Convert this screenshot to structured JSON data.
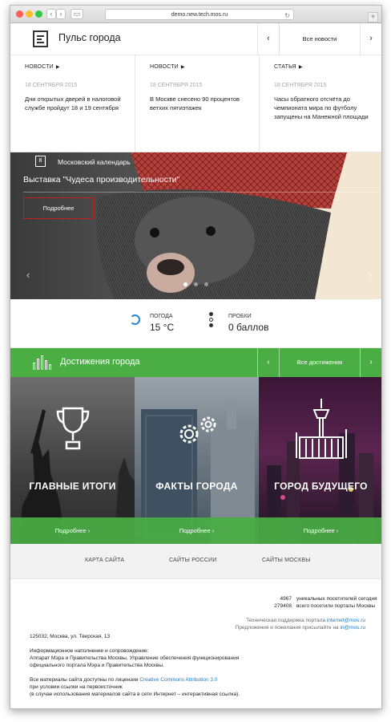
{
  "browser": {
    "url": "demo.new.tech.mos.ru"
  },
  "pulse": {
    "title": "Пульс города",
    "all_news": "Все новости",
    "prev": "‹",
    "next": "›",
    "news": [
      {
        "category": "НОВОСТИ",
        "date": "18 СЕНТЯБРЯ 2015",
        "title": "Дни открытых дверей в налоговой службе пройдут 18 и 19 сентября"
      },
      {
        "category": "НОВОСТИ",
        "date": "18 СЕНТЯБРЯ 2015",
        "title": "В Москве снесено 90 процентов ветхих пятиэтажек"
      },
      {
        "category": "СТАТЬЯ",
        "date": "18 СЕНТЯБРЯ 2015",
        "title": "Часы обратного отсчёта до чемпионата мира по футболу запущены на Манежной площади"
      }
    ]
  },
  "hero": {
    "calendar_day": "8",
    "label": "Московский календарь",
    "headline": "Выставка \"Чудеса производительности\"",
    "more": "Подробнее",
    "prev": "‹",
    "next": "›",
    "slides_total": 3,
    "slide_active": 1
  },
  "weather": {
    "weather_label": "ПОГОДА",
    "weather_value": "15 °С",
    "traffic_label": "ПРОБКИ",
    "traffic_value": "0 баллов"
  },
  "achievements": {
    "title": "Достижения города",
    "all": "Все достижения",
    "prev": "‹",
    "next": "›",
    "tiles": [
      {
        "title": "ГЛАВНЫЕ ИТОГИ",
        "more": "Подробнее  ›",
        "icon": "trophy-icon"
      },
      {
        "title": "ФАКТЫ ГОРОДА",
        "more": "Подробнее  ›",
        "icon": "gears-icon"
      },
      {
        "title": "ГОРОД БУДУЩЕГО",
        "more": "Подробнее  ›",
        "icon": "tower-icon"
      }
    ]
  },
  "footer": {
    "links": [
      "КАРТА САЙТА",
      "САЙТЫ РОССИИ",
      "САЙТЫ МОСКВЫ"
    ],
    "visitors_today_count": "4967",
    "visitors_today_label": "уникальных посетителей сегодня",
    "visitors_total_count": "279408",
    "visitors_total_label": "всего посетили порталы Москвы",
    "support_label": "Техническая поддержка портала",
    "support_email": "internet@mos.ru",
    "feedback_label": "Предложения и пожелания присылайте на",
    "feedback_email": "in@mos.ru",
    "address": "125032, Москва, ул. Тверская, 13",
    "info_1": "Информационное наполнение и сопровождение:",
    "info_2": "Аппарат Мэра и Правительства Москвы, Управление обеспечения функционирования",
    "info_3": "официального портала Мэра и Правительства Москвы.",
    "license_1": "Все материалы сайта доступны по лицензии",
    "license_link": "Creative Commons Attribution 3.0",
    "license_2": "при условии ссылки на первоисточник",
    "license_3": "(в случае использования материалов сайта в сети Интернет – интерактивная ссылка)."
  },
  "colors": {
    "green": "#4aae44",
    "red_border": "#c02222",
    "link_blue": "#1d7cc0"
  }
}
